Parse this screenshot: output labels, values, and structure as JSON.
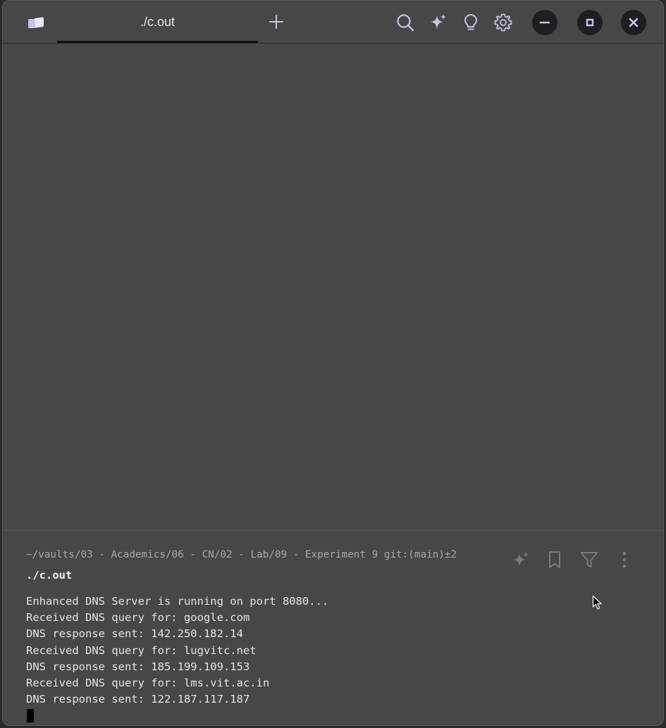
{
  "tabs": [
    {
      "label": "./c.out",
      "active": true
    }
  ],
  "block": {
    "prompt_path": "~/vaults/03 - Academics/06 - CN/02 - Lab/09 - Experiment 9 git:(main)±2",
    "command": "./c.out",
    "output": [
      "Enhanced DNS Server is running on port 8080...",
      "Received DNS query for: google.com",
      "DNS response sent: 142.250.182.14",
      "Received DNS query for: lugvitc.net",
      "DNS response sent: 185.199.109.153",
      "Received DNS query for: lms.vit.ac.in",
      "DNS response sent: 122.187.117.187"
    ]
  },
  "icons": {
    "app": "tabs-panel-icon",
    "new_tab": "plus-icon",
    "search": "search-icon",
    "ai": "sparkle-icon",
    "hint": "lightbulb-icon",
    "settings": "gear-icon",
    "minimize": "minimize-icon",
    "maximize": "maximize-icon",
    "close": "close-icon",
    "block_ai": "sparkle-icon",
    "bookmark": "bookmark-icon",
    "filter": "filter-icon",
    "more": "more-vertical-icon"
  },
  "colors": {
    "background": "#474747",
    "text": "#e4e4e4",
    "prompt": "#a8a8a8",
    "accent": "#c9c2e8"
  }
}
